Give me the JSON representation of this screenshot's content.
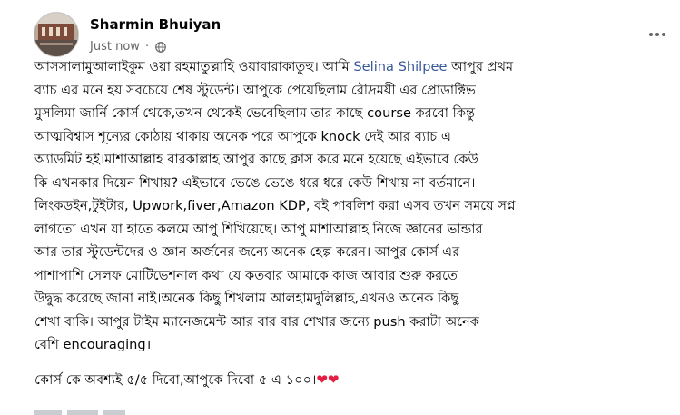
{
  "post": {
    "author": "Sharmin Bhuiyan",
    "timestamp": "Just now",
    "separator": "·",
    "privacy_icon": "globe-icon",
    "more_icon": "more-options-icon",
    "mention": "Selina Shilpee",
    "line1_before": "আসসালামুআলাইকুম ওয়া রহমাতুল্লাহি  ওয়াবারাকাতুহু। আমি ",
    "line1_after": " আপুর প্রথম",
    "lines": [
      "ব্যাচ এর মনে হয় সবচেয়ে শেষ স্টুডেন্ট। আপুকে পেয়েছিলাম রৌদ্রময়ী এর প্রোডাক্টিভ",
      "মুসলিমা জার্নি কোর্স থেকে,তখন থেকেই ভেবেছিলাম তার কাছে course করবো কিন্তু",
      "আত্মবিশ্বাস শূন্যের কোঠায় থাকায় অনেক পরে আপুকে knock দেই আর ব্যাচ এ",
      "অ্যাডমিট হই।মাশাআল্লাহ বারকাল্লাহ আপুর কাছে ক্লাস করে মনে হয়েছে এইভাবে কেউ",
      "কি এখনকার দিয়েন শিখায়? এইভাবে ভেঙে ভেঙে ধরে ধরে কেউ শিখায় না বর্তমানে।",
      "লিংকডইন,টুইটার, Upwork,fiver,Amazon KDP, বই পাবলিশ করা এসব তখন সময়ে সপ্ন",
      "লাগতো এখন যা হাতে কলমে আপু শিখিয়েছে। আপু মাশাআল্লাহ নিজে জ্ঞানের ভান্ডার",
      "আর তার স্টুডেন্টদের ও জ্ঞান অর্জনের জন্যে অনেক হেল্প করেন। আপুর কোর্স এর",
      "পাশাপাশি সেলফ মোটিভেশনাল কথা যে কতবার আমাকে কাজ আবার শুরু করতে",
      "উদ্বুদ্ধ করেছে জানা নাই।অনেক কিছু শিখলাম আলহামদুলিল্লাহ,এখনও অনেক কিছু",
      "শেখা বাকি। আপুর টাইম ম্যানেজমেন্ট আর বার বার শেখার জন্যে push করাটা অনেক",
      "বেশি encouraging।"
    ],
    "final_line": "কোর্স কে অবশ্যই ৫/৫ দিবো,আপুকে দিবো ৫ এ ১০০।",
    "hearts": "❤❤",
    "heart_color": "#e41e3f",
    "mention_color": "#385898"
  }
}
